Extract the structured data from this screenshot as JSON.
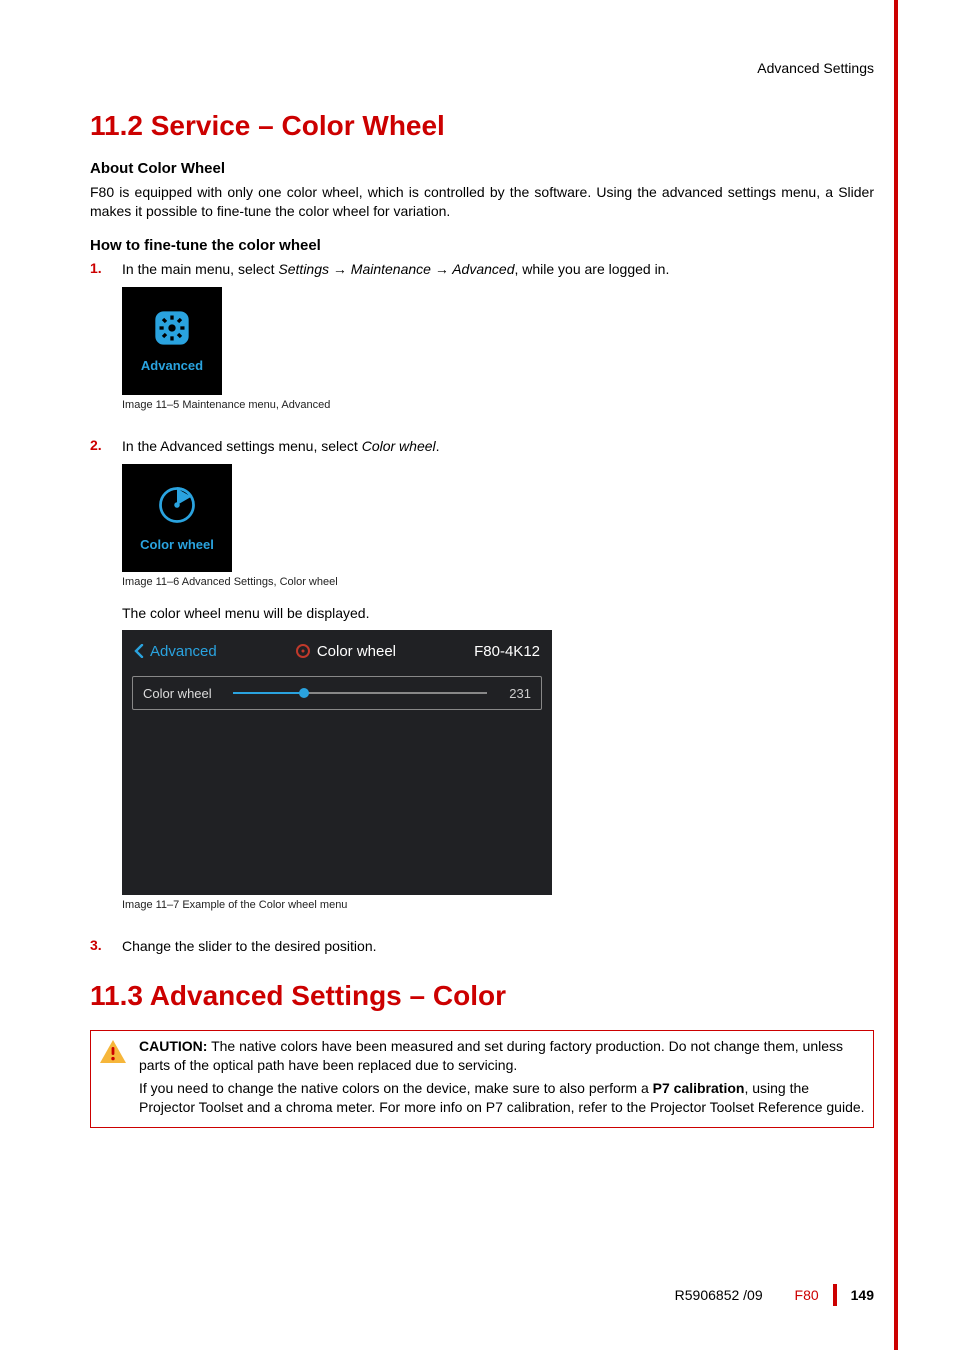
{
  "breadcrumb": "Advanced Settings",
  "section_11_2": {
    "heading": "11.2 Service – Color Wheel",
    "about_heading": "About Color Wheel",
    "about_body": "F80 is equipped with only one color wheel, which is controlled by the software. Using the advanced settings menu, a Slider makes it possible to fine-tune the color wheel for variation.",
    "howto_heading": "How to fine-tune the color wheel",
    "steps": [
      {
        "num": "1.",
        "pre": "In the main menu, select ",
        "path": "Settings → Maintenance → Advanced",
        "post": ", while you are logged in.",
        "tile_label": "Advanced",
        "caption": "Image 11–5  Maintenance menu, Advanced"
      },
      {
        "num": "2.",
        "pre": "In the Advanced settings menu, select ",
        "path": "Color wheel",
        "post": ".",
        "tile_label": "Color wheel",
        "caption": "Image 11–6  Advanced Settings, Color wheel",
        "note": "The color wheel menu will be displayed.",
        "menu": {
          "back": "Advanced",
          "title": "Color wheel",
          "model": "F80-4K12",
          "slider_label": "Color wheel",
          "slider_value": "231"
        },
        "menu_caption": "Image 11–7  Example of the Color wheel menu"
      },
      {
        "num": "3.",
        "text": "Change the slider to the desired position."
      }
    ]
  },
  "section_11_3": {
    "heading": "11.3 Advanced Settings – Color",
    "caution": {
      "label": "CAUTION:",
      "p1": " The native colors have been measured and set during factory production. Do not change them, unless parts of the optical path have been replaced due to servicing.",
      "p2_pre": "If you need to change the native colors on the device, make sure to also perform a ",
      "p2_bold": "P7 calibration",
      "p2_post": ", using the Projector Toolset and a chroma meter. For more info on P7 calibration, refer to the Projector Toolset Reference guide."
    }
  },
  "footer": {
    "doc": "R5906852 /09",
    "model": "F80",
    "page": "149"
  }
}
